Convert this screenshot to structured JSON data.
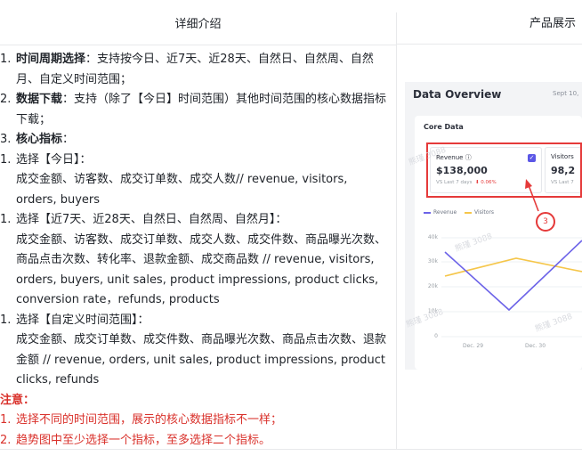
{
  "header": {
    "left_title": "详细介绍",
    "right_title": "产品展示"
  },
  "items": [
    {
      "num": "1.",
      "label": "时间周期选择",
      "text": "：支持按今日、近7天、近28天、自然日、自然周、自然月、自定义时间范围；"
    },
    {
      "num": "2.",
      "label": "数据下载",
      "text": "：支持（除了【今日】时间范围）其他时间范围的核心数据指标下载；"
    },
    {
      "num": "3.",
      "label": "核心指标",
      "text": "："
    }
  ],
  "sub_items": [
    {
      "num": "1.",
      "title": "选择【今日】：",
      "text": "成交金额、访客数、成交订单数、成交人数// revenue, visitors, orders, buyers"
    },
    {
      "num": "1.",
      "title": "选择【近7天、近28天、自然日、自然周、自然月】：",
      "text": "成交金额、访客数、成交订单数、成交人数、成交件数、商品曝光次数、商品点击次数、转化率、退款金额、成交商品数 // revenue, visitors, orders, buyers, unit sales, product impressions, product clicks, conversion rate，refunds, products"
    },
    {
      "num": "1.",
      "title": "选择【自定义时间范围】：",
      "text": "成交金额、成交订单数、成交件数、商品曝光次数、商品点击次数、退款金额 // revenue, orders, unit sales, product impressions, product clicks, refunds"
    }
  ],
  "notes": {
    "label": "注意：",
    "items": [
      {
        "num": "1.",
        "text": "选择不同的时间范围，展示的核心数据指标不一样；"
      },
      {
        "num": "2.",
        "text": "趋势图中至少选择一个指标，至多选择二个指标。"
      }
    ]
  },
  "product_image": {
    "title": "Data Overview",
    "date": "Sept 10,",
    "section": "Core Data",
    "metric1": {
      "label": "Revenue ⓘ",
      "value": "$138,000",
      "vs": "VS Last 7 days",
      "change": "⬇ 0.06%",
      "check": "✓"
    },
    "metric2": {
      "label": "Visitors",
      "value": "98,2",
      "vs": "VS Last 7"
    },
    "annotation": "3",
    "legend": [
      "Revenue",
      "Visitors"
    ],
    "yticks": [
      "40k",
      "30k",
      "20k",
      "10k",
      "0"
    ],
    "xticks": [
      "Dec. 29",
      "Dec. 30"
    ],
    "watermarks": [
      "熊瑾 3088",
      "熊瑾 3088",
      "熊瑾 3088",
      "熊瑾 3088"
    ],
    "colors": {
      "revenue": "#6c63e8",
      "visitors": "#f5c64a",
      "highlight": "#e53a3a"
    }
  }
}
